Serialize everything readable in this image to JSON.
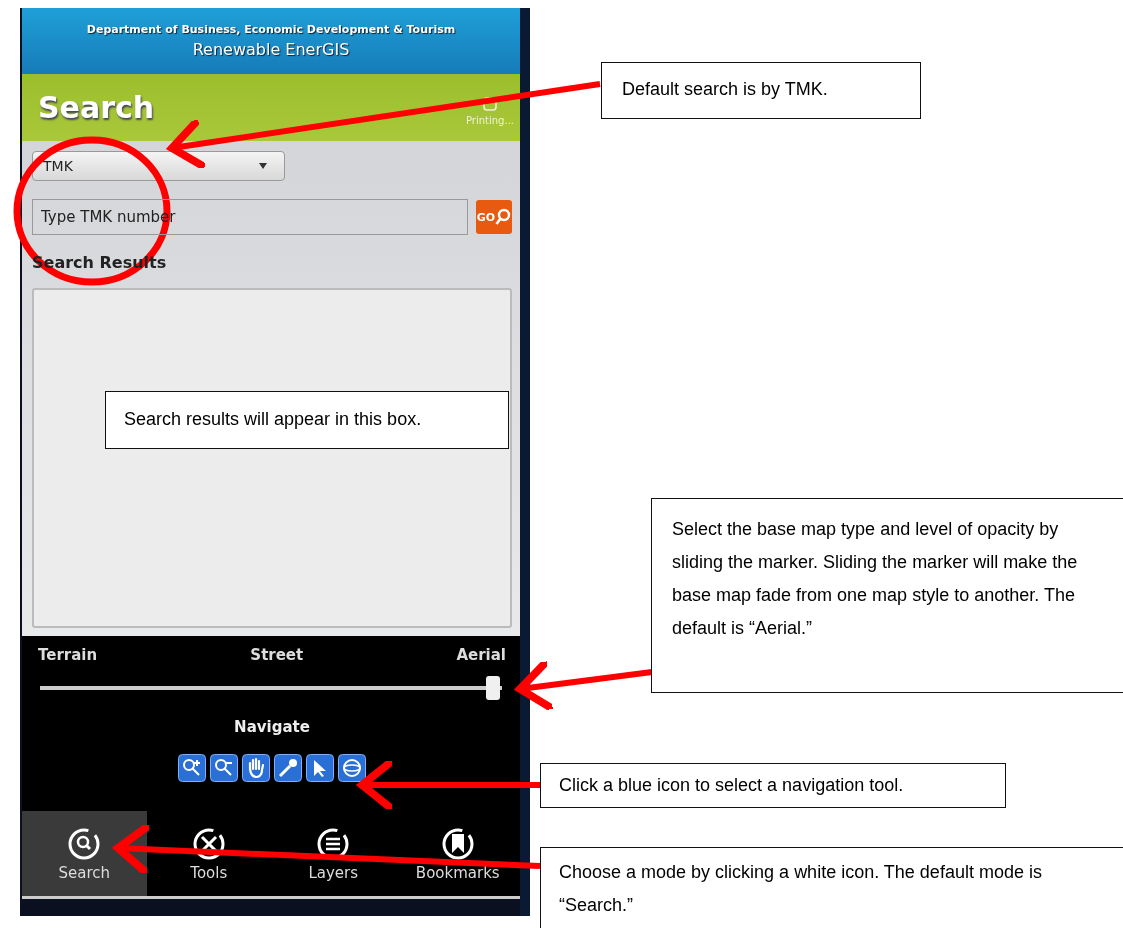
{
  "header": {
    "agency": "Department of Business, Economic Development & Tourism",
    "app_title": "Renewable EnerGIS"
  },
  "panel": {
    "title": "Search",
    "printing_label": "Printing..."
  },
  "search": {
    "type_value": "TMK",
    "placeholder": "Type TMK number",
    "go_label": "GO",
    "results_heading": "Search Results"
  },
  "basemap": {
    "labels": [
      "Terrain",
      "Street",
      "Aerial"
    ],
    "level": 0.98
  },
  "navigate": {
    "title": "Navigate"
  },
  "modes": [
    {
      "label": "Search",
      "kind": "search",
      "selected": true
    },
    {
      "label": "Tools",
      "kind": "tools",
      "selected": false
    },
    {
      "label": "Layers",
      "kind": "layers",
      "selected": false
    },
    {
      "label": "Bookmarks",
      "kind": "bookmarks",
      "selected": false
    }
  ],
  "annotations": [
    {
      "kind": "default-search",
      "text": "Default search is by TMK."
    },
    {
      "kind": "results",
      "text": "Search results will appear in this box."
    },
    {
      "kind": "basemap",
      "text": "Select the base map type and level of opacity by sliding the marker. Sliding the marker will make the base map fade from one map style to another. The default is “Aerial.”"
    },
    {
      "kind": "navigate",
      "text": "Click a blue icon to select a navigation tool."
    },
    {
      "kind": "mode",
      "text": "Choose a mode by clicking a white icon.  The default mode is “Search.”"
    }
  ]
}
